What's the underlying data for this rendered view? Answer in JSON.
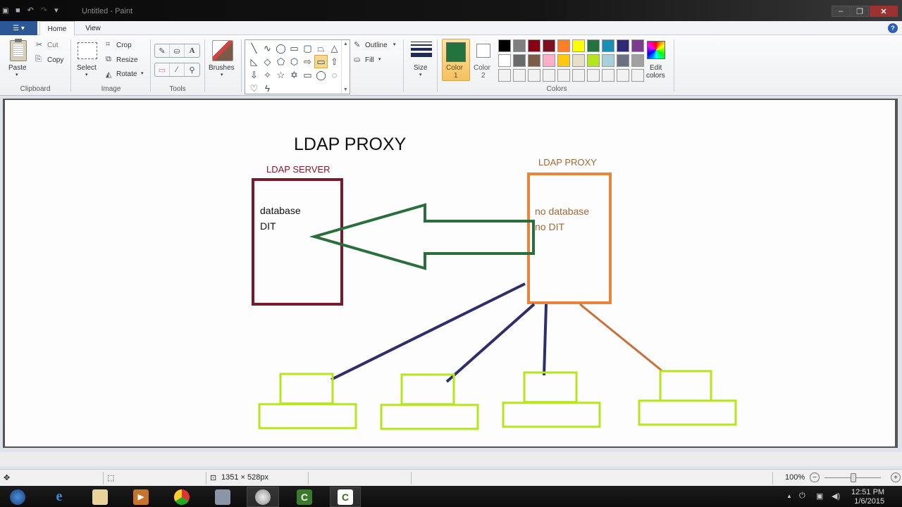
{
  "window": {
    "title": "Untitled - Paint",
    "app_icon": "paint-app-icon",
    "quick_access": [
      "save-icon",
      "undo-icon",
      "redo-icon",
      "customize-dropdown-icon"
    ],
    "controls": {
      "minimize": "–",
      "maximize": "❐",
      "close": "✕"
    }
  },
  "ribbon": {
    "file_menu_glyph": "☰ ▾",
    "tabs": [
      {
        "label": "Home",
        "active": true
      },
      {
        "label": "View",
        "active": false
      }
    ],
    "help_glyph": "?",
    "groups": {
      "clipboard": {
        "label": "Clipboard",
        "paste": "Paste",
        "cut": "Cut",
        "copy": "Copy"
      },
      "image": {
        "label": "Image",
        "select": "Select",
        "crop": "Crop",
        "resize": "Resize",
        "rotate": "Rotate"
      },
      "tools": {
        "label": "Tools",
        "items": [
          "pencil",
          "fill",
          "text",
          "eraser",
          "color-picker",
          "magnifier"
        ],
        "glyphs": [
          "✎",
          "⛀",
          "A",
          "▭",
          "⁄",
          "⚲"
        ]
      },
      "brushes": {
        "label": "Brushes"
      },
      "shapes": {
        "glyphs": [
          "╲",
          "∿",
          "◯",
          "▭",
          "▢",
          "⏢",
          "△",
          "◺",
          "◇",
          "⬠",
          "⬡",
          "⇨",
          "▭",
          "⇧",
          "⇩",
          "✧",
          "☆",
          "✡",
          "▭",
          "◯",
          "◌",
          "♡",
          "ϟ"
        ],
        "selected_index": 12,
        "outline": "Outline",
        "fill": "Fill"
      },
      "size": {
        "label": "Size"
      },
      "colors": {
        "label": "Colors",
        "color1_label": "Color\n1",
        "color1_line1": "Color",
        "color1_line2": "1",
        "color2_line1": "Color",
        "color2_line2": "2",
        "color1": "#22733e",
        "color2": "#ffffff",
        "palette": [
          "#000000",
          "#7f7f7f",
          "#880015",
          "#7a1020",
          "#ff7f27",
          "#ffff00",
          "#22733e",
          "#1a8fb5",
          "#2e2a77",
          "#7b3d8c",
          "#ffffff",
          "#6a6a6a",
          "#7a5c48",
          "#ffaec9",
          "#ffc90e",
          "#e6e0c8",
          "#b5e61d",
          "#a8d0d8",
          "#6a7280",
          "#a0a0a0",
          "#f2f2f2",
          "#f2f2f2",
          "#f2f2f2",
          "#f2f2f2",
          "#f2f2f2",
          "#f2f2f2",
          "#f2f2f2",
          "#f2f2f2",
          "#f2f2f2",
          "#f2f2f2"
        ],
        "edit_colors_line1": "Edit",
        "edit_colors_line2": "colors"
      }
    }
  },
  "drawing": {
    "title": "LDAP PROXY",
    "server": {
      "label": "LDAP SERVER",
      "line1": "database",
      "line2": "DIT",
      "color": "#7a1a2a"
    },
    "proxy": {
      "label": "LDAP PROXY",
      "line1": "no database",
      "line2": "no DIT",
      "color": "#e8843c",
      "text_color": "#a0673a"
    },
    "arrow_color": "#2a6e3e",
    "client_color": "#b5e61d",
    "link_colors": [
      "#2e2f6a",
      "#2e2f6a",
      "#2e2f6a",
      "#c8703a"
    ],
    "clients_count": 4
  },
  "statusbar": {
    "move_icon": "✥",
    "selection_icon": "⬚",
    "canvas_size_icon": "⊡",
    "canvas_size": "1351 × 528px",
    "zoom": "100%",
    "zoom_level_percent": 100
  },
  "taskbar": {
    "items": [
      "start-button",
      "internet-explorer",
      "windows-explorer",
      "media-player",
      "chrome",
      "virtualbox",
      "paint",
      "camtasia",
      "camtasia-recorder"
    ],
    "tray_glyphs": [
      "▲",
      "🔌",
      "🖧",
      "🔊"
    ],
    "time": "12:51 PM",
    "date": "1/6/2015"
  }
}
